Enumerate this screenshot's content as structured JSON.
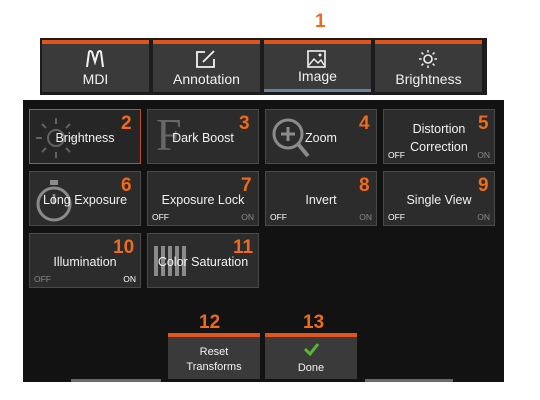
{
  "callouts": [
    "1",
    "2",
    "3",
    "4",
    "5",
    "6",
    "7",
    "8",
    "9",
    "10",
    "11",
    "12",
    "13"
  ],
  "tabs": [
    {
      "label": "MDI",
      "icon": "mdi-icon"
    },
    {
      "label": "Annotation",
      "icon": "annotation-edit-icon"
    },
    {
      "label": "Image",
      "icon": "image-icon"
    },
    {
      "label": "Brightness",
      "icon": "sun-icon"
    }
  ],
  "tiles": {
    "brightness": {
      "label": "Brightness",
      "icon": "sun-icon"
    },
    "dark_boost": {
      "label": "Dark Boost",
      "icon": "letter-f-icon"
    },
    "zoom": {
      "label": "Zoom",
      "icon": "zoom-in-icon"
    },
    "distortion": {
      "label_line1": "Distortion",
      "label_line2": "Correction",
      "off": "OFF",
      "on": "ON"
    },
    "long_exposure": {
      "label": "Long Exposure",
      "icon": "stopwatch-icon"
    },
    "exposure_lock": {
      "label": "Exposure Lock",
      "off": "OFF",
      "on": "ON"
    },
    "invert": {
      "label": "Invert",
      "off": "OFF",
      "on": "ON"
    },
    "single_view": {
      "label": "Single View",
      "off": "OFF",
      "on": "ON"
    },
    "illumination": {
      "label": "Illumination",
      "off": "OFF",
      "on": "ON"
    },
    "color_saturation": {
      "label": "Color Saturation",
      "icon": "saturation-bars-icon"
    }
  },
  "buttons": {
    "reset_line1": "Reset",
    "reset_line2": "Transforms",
    "done": "Done",
    "done_icon": "checkmark-icon"
  },
  "colors": {
    "accent": "#e0541b",
    "callout": "#f06a1a",
    "check": "#5cb531"
  }
}
